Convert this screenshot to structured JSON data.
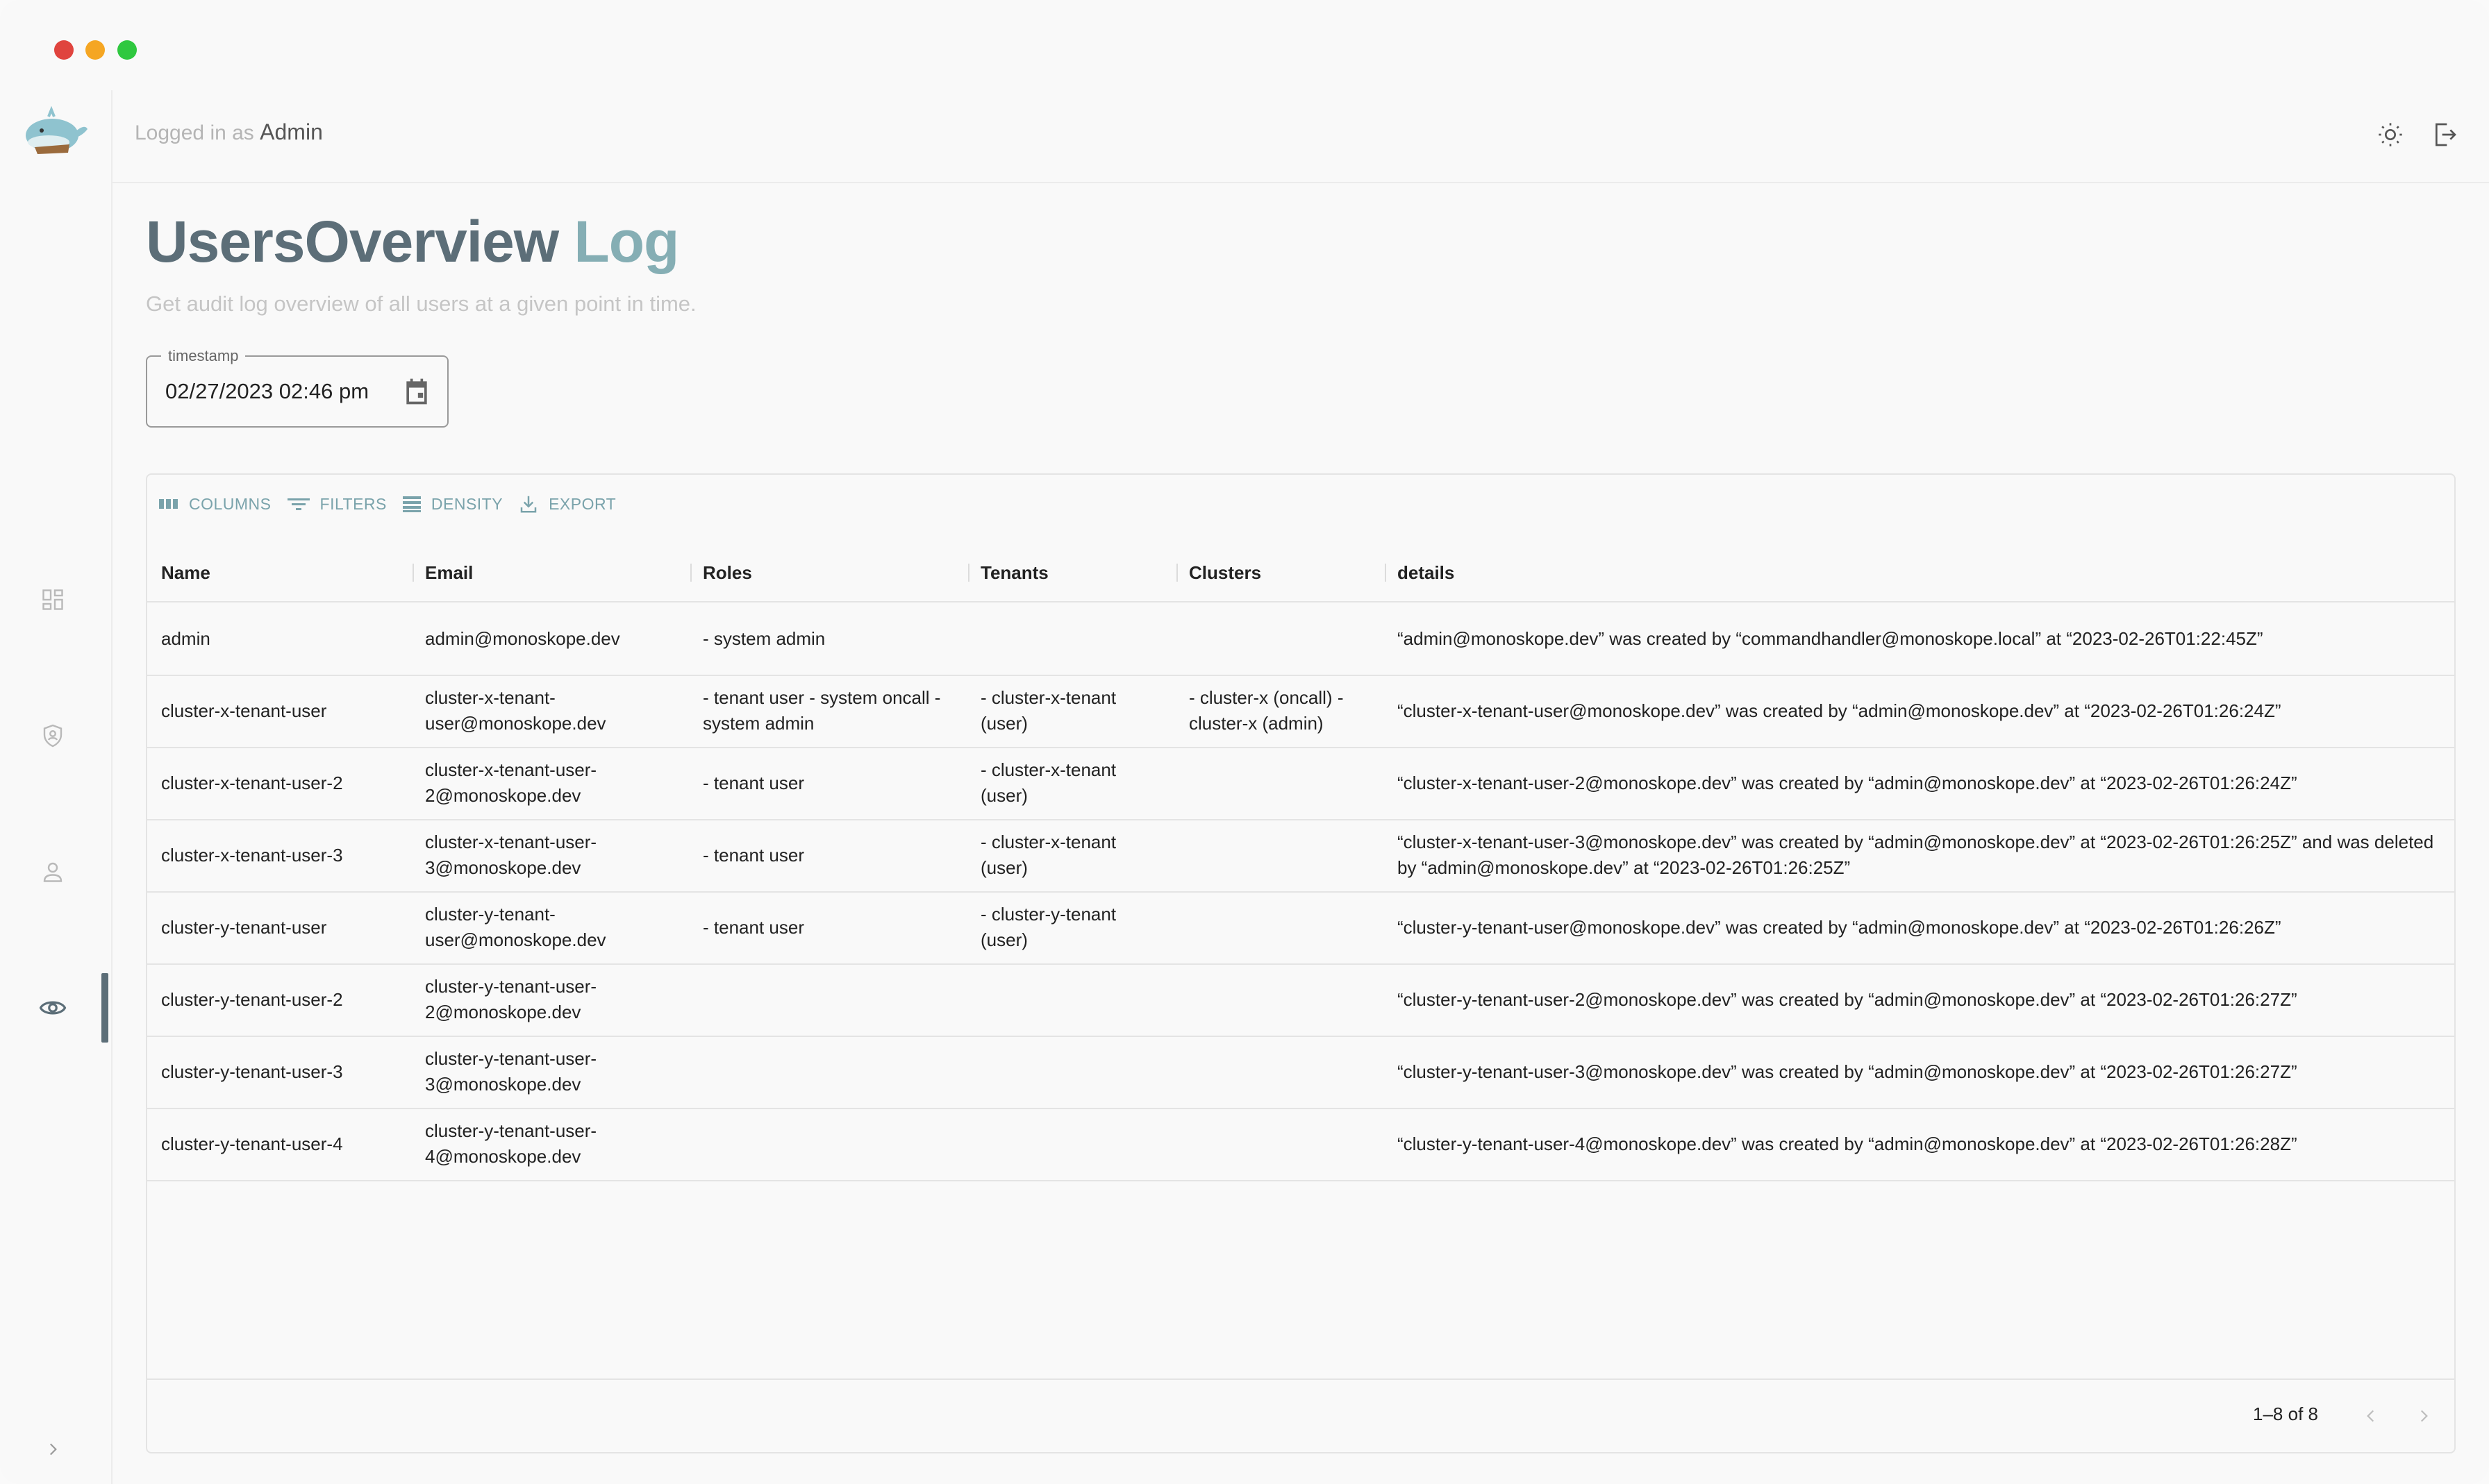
{
  "topbar": {
    "logged_prefix": "Logged in as",
    "user": "Admin"
  },
  "page": {
    "title_main": "UsersOverview",
    "title_accent": "Log",
    "subtitle": "Get audit log overview of all users at a given point in time."
  },
  "timestamp": {
    "label": "timestamp",
    "value": "02/27/2023 02:46 pm"
  },
  "toolbar": {
    "columns": "COLUMNS",
    "filters": "FILTERS",
    "density": "DENSITY",
    "export": "EXPORT"
  },
  "table": {
    "headers": {
      "name": "Name",
      "email": "Email",
      "roles": "Roles",
      "tenants": "Tenants",
      "clusters": "Clusters",
      "details": "details"
    },
    "rows": [
      {
        "name": "admin",
        "email": "admin@monoskope.dev",
        "roles": "- system admin",
        "tenants": "",
        "clusters": "",
        "details": "“admin@monoskope.dev” was created by “commandhandler@monoskope.local” at “2023-02-26T01:22:45Z”"
      },
      {
        "name": "cluster-x-tenant-user",
        "email": "cluster-x-tenant-user@monoskope.dev",
        "roles": "- tenant user - system oncall - system admin",
        "tenants": "- cluster-x-tenant (user)",
        "clusters": "- cluster-x (oncall) - cluster-x (admin)",
        "details": "“cluster-x-tenant-user@monoskope.dev” was created by “admin@monoskope.dev” at “2023-02-26T01:26:24Z”"
      },
      {
        "name": "cluster-x-tenant-user-2",
        "email": "cluster-x-tenant-user-2@monoskope.dev",
        "roles": "- tenant user",
        "tenants": "- cluster-x-tenant (user)",
        "clusters": "",
        "details": "“cluster-x-tenant-user-2@monoskope.dev” was created by “admin@monoskope.dev” at “2023-02-26T01:26:24Z”"
      },
      {
        "name": "cluster-x-tenant-user-3",
        "email": "cluster-x-tenant-user-3@monoskope.dev",
        "roles": "- tenant user",
        "tenants": "- cluster-x-tenant (user)",
        "clusters": "",
        "details": "“cluster-x-tenant-user-3@monoskope.dev” was created by “admin@monoskope.dev” at “2023-02-26T01:26:25Z” and was deleted by “admin@monoskope.dev” at “2023-02-26T01:26:25Z”"
      },
      {
        "name": "cluster-y-tenant-user",
        "email": "cluster-y-tenant-user@monoskope.dev",
        "roles": "- tenant user",
        "tenants": "- cluster-y-tenant (user)",
        "clusters": "",
        "details": "“cluster-y-tenant-user@monoskope.dev” was created by “admin@monoskope.dev” at “2023-02-26T01:26:26Z”"
      },
      {
        "name": "cluster-y-tenant-user-2",
        "email": "cluster-y-tenant-user-2@monoskope.dev",
        "roles": "",
        "tenants": "",
        "clusters": "",
        "details": "“cluster-y-tenant-user-2@monoskope.dev” was created by “admin@monoskope.dev” at “2023-02-26T01:26:27Z”"
      },
      {
        "name": "cluster-y-tenant-user-3",
        "email": "cluster-y-tenant-user-3@monoskope.dev",
        "roles": "",
        "tenants": "",
        "clusters": "",
        "details": "“cluster-y-tenant-user-3@monoskope.dev” was created by “admin@monoskope.dev” at “2023-02-26T01:26:27Z”"
      },
      {
        "name": "cluster-y-tenant-user-4",
        "email": "cluster-y-tenant-user-4@monoskope.dev",
        "roles": "",
        "tenants": "",
        "clusters": "",
        "details": "“cluster-y-tenant-user-4@monoskope.dev” was created by “admin@monoskope.dev” at “2023-02-26T01:26:28Z”"
      }
    ]
  },
  "pagination": {
    "text": "1–8 of 8"
  },
  "icons": {
    "sidebar": [
      "dashboard-icon",
      "admin-shield-icon",
      "user-icon",
      "eye-icon",
      "chevron-right-icon"
    ],
    "topbar": [
      "sun-icon",
      "logout-icon"
    ]
  },
  "colors": {
    "title": "#5c6e78",
    "accent": "#85aeb4",
    "toolbar": "#7aa3ab"
  }
}
